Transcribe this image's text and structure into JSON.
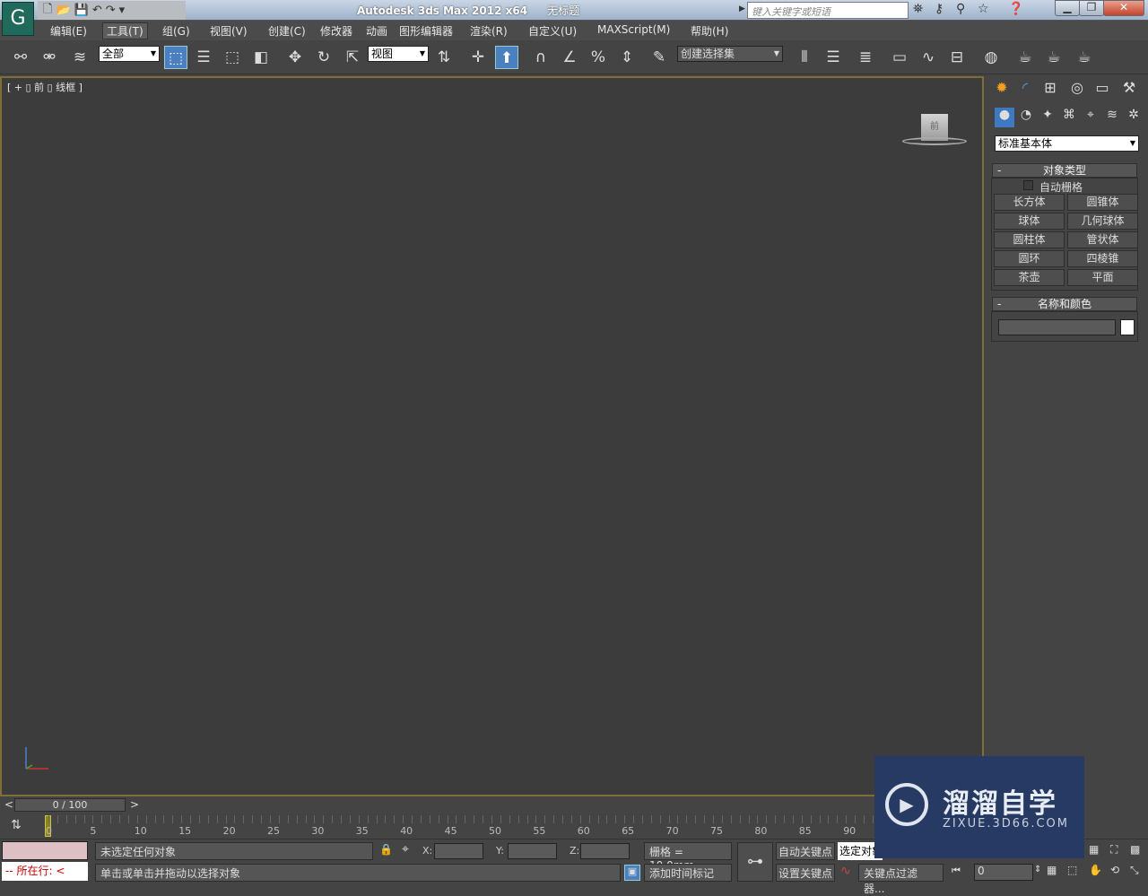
{
  "title": {
    "app": "Autodesk 3ds Max  2012 x64",
    "doc": "无标题",
    "search_placeholder": "键入关键字或短语"
  },
  "menu": [
    "编辑(E)",
    "工具(T)",
    "组(G)",
    "视图(V)",
    "创建(C)",
    "修改器",
    "动画",
    "图形编辑器",
    "渲染(R)",
    "自定义(U)",
    "MAXScript(M)",
    "帮助(H)"
  ],
  "menu_active": 1,
  "toolbar": {
    "filter": "全部",
    "ref_coord": "视图",
    "named_sel": "创建选择集"
  },
  "viewport": {
    "label": "[ + ▯ 前 ▯ 线框 ]",
    "cube_label": "前"
  },
  "panel": {
    "category": "标准基本体",
    "object_type": "对象类型",
    "autogrid": "自动栅格",
    "objects": [
      "长方体",
      "圆锥体",
      "球体",
      "几何球体",
      "圆柱体",
      "管状体",
      "圆环",
      "四棱锥",
      "茶壶",
      "平面"
    ],
    "name_color": "名称和颜色",
    "color": "#ffffff"
  },
  "timeline": {
    "frame": "0 / 100",
    "ticks": [
      "0",
      "5",
      "10",
      "15",
      "20",
      "25",
      "30",
      "35",
      "40",
      "45",
      "50",
      "55",
      "60",
      "65",
      "70",
      "75",
      "80",
      "85",
      "90"
    ]
  },
  "status": {
    "selection": "未选定任何对象",
    "prompt": "单击或单击并拖动以选择对象",
    "script_line": "-- 所在行: <",
    "x_label": "X:",
    "y_label": "Y:",
    "z_label": "Z:",
    "grid": "栅格 = 10.0mm",
    "add_tag": "添加时间标记",
    "auto_key": "自动关键点",
    "set_key": "设置关键点",
    "sel_dropdown": "选定对象",
    "key_filters": "关键点过滤器...",
    "frame_value": "0"
  },
  "watermark": {
    "name": "溜溜自学",
    "url": "ZIXUE.3D66.COM"
  }
}
